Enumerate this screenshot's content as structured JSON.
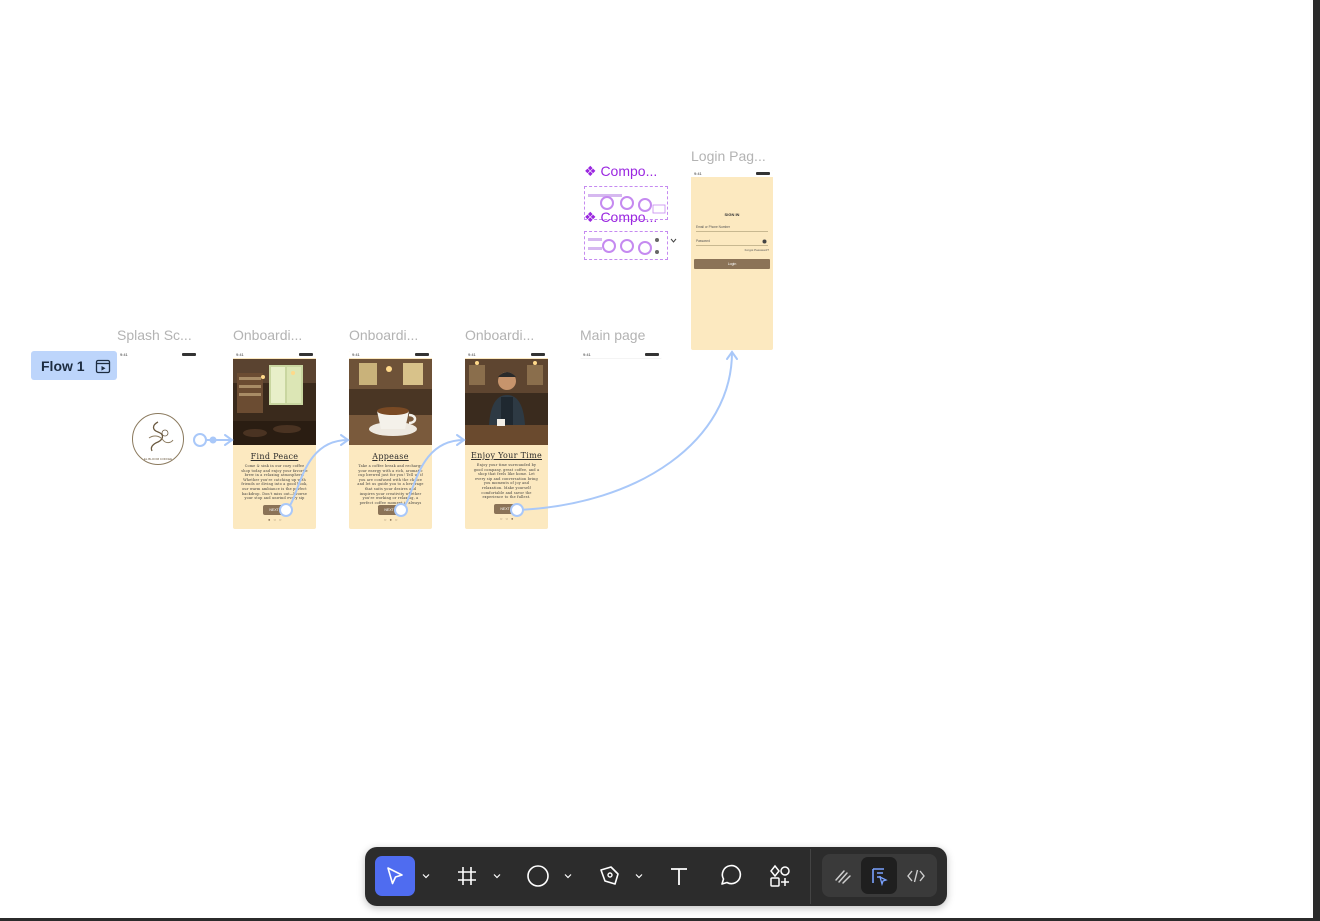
{
  "flow": {
    "label": "Flow 1"
  },
  "frames": {
    "splash": "Splash Sc...",
    "onboarding1": "Onboardi...",
    "onboarding2": "Onboardi...",
    "onboarding3": "Onboardi...",
    "main": "Main page",
    "login": "Login Pag..."
  },
  "components": {
    "label1": "❖ Compo...",
    "label2": "❖ Compo..."
  },
  "status_time": "9:41",
  "splash": {
    "logo_text": "EL BLOOM COFFEE"
  },
  "onboarding": [
    {
      "title": "Find Peace",
      "body": "Come & sink in our cozy coffee shop today and enjoy your favorite brew in a relaxing atmosphere. Whether you're catching up with friends or diving into a good book, our warm ambiance is the perfect backdrop. Don't miss out—browse your stop and unwind every sip",
      "button": "NEXT",
      "pager": "● ○ ○"
    },
    {
      "title": "Appease",
      "body": "Take a coffee break and recharge your energy with a rich, aromatic cup brewed just for you! Tell us if you are confused with the choice and let us guide you to a beverage that suits your desires and inspires your creativity whether you're working or relaxing, a perfect coffee moment is always within reach.",
      "button": "NEXT",
      "pager": "○ ● ○"
    },
    {
      "title": "Enjoy Your Time",
      "body": "Enjoy your time surrounded by good company, great coffee, and a shop that feels like home. Let every sip and conversation bring you moments of joy and relaxation. Make yourself comfortable and savor the experience to the fullest.",
      "button": "NEXT",
      "pager": "○ ○ ●"
    }
  ],
  "login": {
    "heading": "SIGN IN",
    "email_placeholder": "Email or Phone Number",
    "password_placeholder": "Password",
    "forgot": "Forgot Password?",
    "button": "Login"
  },
  "toolbar": {
    "tools": [
      "move",
      "frame",
      "shape",
      "pen",
      "text",
      "comment",
      "actions"
    ],
    "modes": [
      "draw",
      "design",
      "dev"
    ]
  },
  "colors": {
    "screen_bg": "#fce9c0",
    "flow_connector": "#a9c8f9",
    "component_purple": "#9a27e0",
    "toolbar_bg": "#2c2c2c",
    "active_tool": "#4f6cf0"
  }
}
